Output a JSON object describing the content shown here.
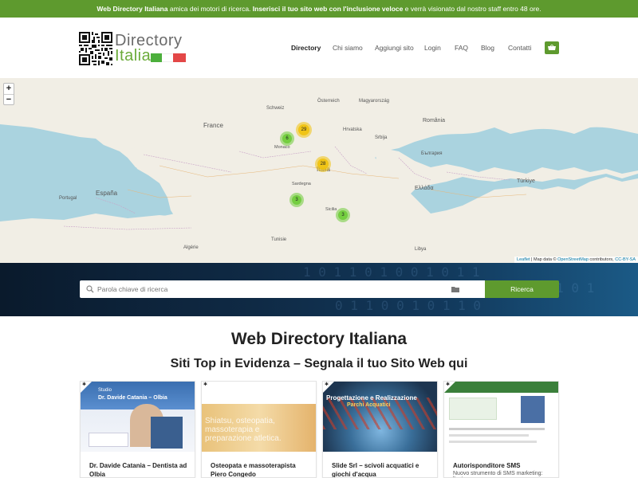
{
  "topbar": {
    "brand": "Web Directory Italiana",
    "text1": " amica dei motori di ricerca. ",
    "strong": "Inserisci il tuo sito web con l'inclusione veloce",
    "text2": " e verrà visionato dal nostro staff entro 48 ore."
  },
  "logo": {
    "line1": "Directory",
    "line2": "Italia"
  },
  "nav": {
    "items": [
      {
        "label": "Directory",
        "active": true
      },
      {
        "label": "Chi siamo"
      },
      {
        "label": "Aggiungi sito"
      },
      {
        "label": "Login"
      },
      {
        "label": "FAQ"
      },
      {
        "label": "Blog"
      },
      {
        "label": "Contatti"
      }
    ],
    "cart_icon": "shopping-basket-icon"
  },
  "map": {
    "zoom_in": "+",
    "zoom_out": "−",
    "attribution_leaflet": "Leaflet",
    "attribution_text": " | Map data © ",
    "attribution_osm": "OpenStreetMap",
    "attribution_rest": " contributors, ",
    "attribution_cc": "CC-BY-SA",
    "clusters": [
      {
        "count": "29",
        "color": "yellow"
      },
      {
        "count": "6",
        "color": "green"
      },
      {
        "count": "28",
        "color": "yellow"
      },
      {
        "count": "3",
        "color": "green"
      },
      {
        "count": "3",
        "color": "green"
      }
    ],
    "places": [
      "France",
      "Italia",
      "España",
      "Schweiz",
      "Österreich",
      "Magyarország",
      "România",
      "Hrvatska",
      "Srbija",
      "България",
      "Ελλάδα",
      "Türkiye",
      "Tunisie",
      "Algérie",
      "Portugal",
      "Monaco",
      "Sicilia",
      "Sardegna",
      "Libya"
    ]
  },
  "search": {
    "placeholder": "Parola chiave di ricerca",
    "button": "Ricerca",
    "search_icon": "search-icon",
    "folder_icon": "folder-icon"
  },
  "headings": {
    "title": "Web Directory Italiana",
    "subtitle": "Siti Top in Evidenza – Segnala il tuo Sito Web qui"
  },
  "cards": [
    {
      "title": "Dr. Davide Catania – Dentista ad Olbia",
      "thumb_text": "Dr. Davide Catania – Olbia",
      "thumb_label": "Studio"
    },
    {
      "title": "Osteopata e massoterapista Piero Congedo",
      "thumb_text": "Shiatsu, osteopatia, massoterapia e preparazione atletica."
    },
    {
      "title": "Slide Srl – scivoli acquatici e giochi d'acqua",
      "thumb_text": "Progettazione e Realizzazione",
      "thumb_text2": "Parchi Acquatici"
    },
    {
      "title": "Autorisponditore SMS",
      "sub": "Nuovo strumento di SMS marketing: l'auto"
    }
  ]
}
